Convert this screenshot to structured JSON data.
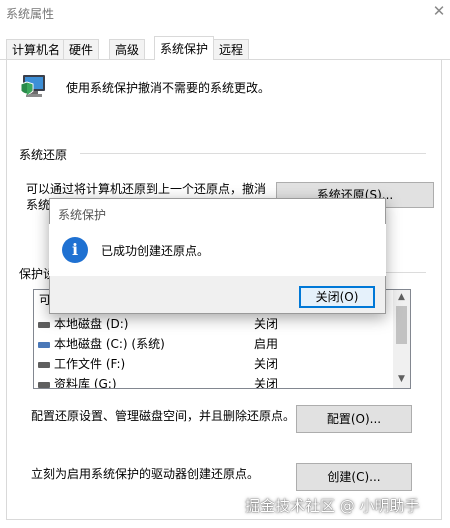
{
  "window": {
    "title": "系统属性",
    "close_glyph": "✕"
  },
  "tabs": [
    {
      "label": "计算机名",
      "active": false
    },
    {
      "label": "硬件",
      "active": false
    },
    {
      "label": "高级",
      "active": false
    },
    {
      "label": "系统保护",
      "active": true
    },
    {
      "label": "远程",
      "active": false
    }
  ],
  "intro": {
    "icon": "computer-shield-icon",
    "text": "使用系统保护撤消不需要的系统更改。"
  },
  "restore_group": {
    "label": "系统还原",
    "description_line1": "可以通过将计算机还原到上一个还原点，撤消",
    "description_line2": "系统",
    "button_label": "系统还原(S)..."
  },
  "protection_group": {
    "label": "保护设",
    "list_header": "可",
    "drives": [
      {
        "name": "本地磁盘 (D:)",
        "state": "关闭",
        "icon": "drive-icon"
      },
      {
        "name": "本地磁盘 (C:) (系统)",
        "state": "启用",
        "icon": "system-drive-icon"
      },
      {
        "name": "工作文件 (F:)",
        "state": "关闭",
        "icon": "drive-icon"
      },
      {
        "name": "资料库 (G:)",
        "state": "关闭",
        "icon": "drive-icon"
      }
    ]
  },
  "configure": {
    "text": "配置还原设置、管理磁盘空间，并且删除还原点。",
    "button_label": "配置(O)..."
  },
  "create": {
    "text": "立刻为启用系统保护的驱动器创建还原点。",
    "button_label": "创建(C)..."
  },
  "dialog": {
    "title": "系统保护",
    "icon": "info-icon",
    "icon_glyph": "i",
    "message": "已成功创建还原点。",
    "close_button_label": "关闭(O)"
  },
  "watermark": "掘金技术社区 @ 小明助手",
  "colors": {
    "accent": "#0078d7",
    "info_icon": "#1f71d2"
  }
}
